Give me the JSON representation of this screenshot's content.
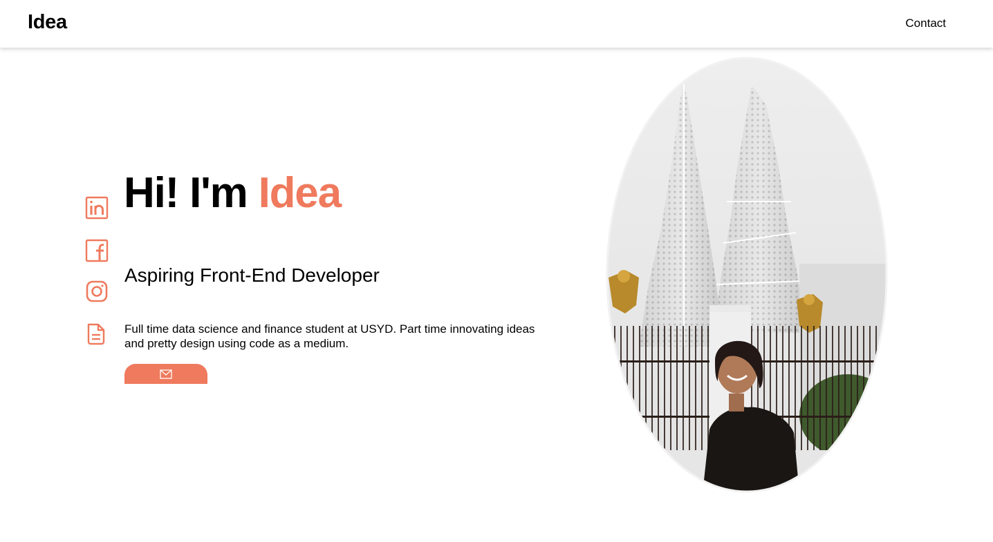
{
  "header": {
    "logo": "Idea",
    "nav_contact": "Contact"
  },
  "socials": [
    {
      "name": "linkedin-icon"
    },
    {
      "name": "facebook-icon"
    },
    {
      "name": "instagram-icon"
    },
    {
      "name": "document-icon"
    }
  ],
  "hero": {
    "greeting": "Hi! I'm ",
    "name": "Idea",
    "subtitle": "Aspiring Front-End Developer",
    "description": "Full time data science and finance student at USYD. Part time innovating ideas and pretty design using code as a medium.",
    "mail_icon": "mail-icon"
  },
  "photo": {
    "description_icon": "profile-photo"
  },
  "colors": {
    "accent": "#ef7a5d",
    "text": "#000000",
    "background": "#ffffff"
  }
}
